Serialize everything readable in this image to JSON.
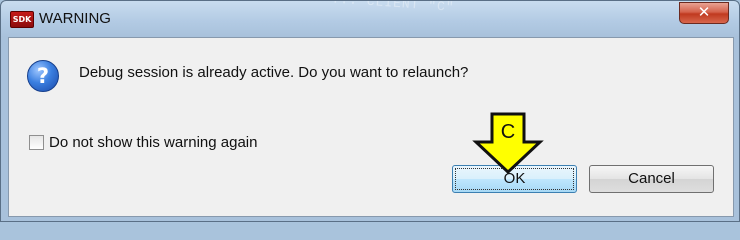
{
  "window": {
    "title": "WARNING",
    "app_icon_text": "SDK",
    "close_glyph": "✕",
    "background_ghost_text": "... CLIENT \"C\""
  },
  "dialog": {
    "icon": "question-icon",
    "icon_glyph": "?",
    "message": "Debug session is already active. Do you want to relaunch?",
    "checkbox": {
      "label": "Do not show this warning again",
      "checked": false
    },
    "buttons": {
      "ok": "OK",
      "cancel": "Cancel"
    }
  },
  "annotation": {
    "label": "C",
    "color": "#ffff00",
    "icon": "down-arrow-icon"
  }
}
